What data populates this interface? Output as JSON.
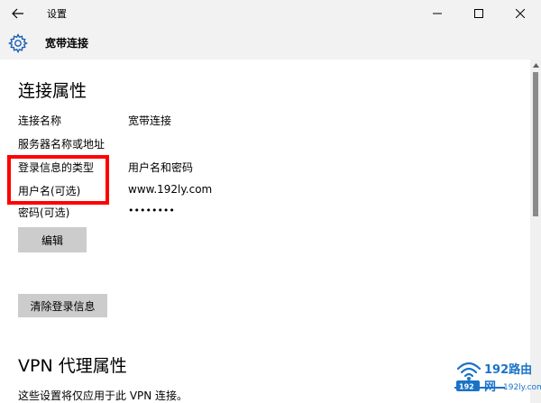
{
  "window": {
    "title": "设置",
    "back_icon": "back-arrow-icon",
    "minimize_icon": "minimize-icon",
    "maximize_icon": "maximize-icon",
    "close_icon": "close-icon"
  },
  "header": {
    "icon": "gear-icon",
    "title": "宽带连接"
  },
  "connection_properties": {
    "heading": "连接属性",
    "rows": [
      {
        "label": "连接名称",
        "value": "宽带连接"
      },
      {
        "label": "服务器名称或地址",
        "value": ""
      },
      {
        "label": "登录信息的类型",
        "value": "用户名和密码"
      },
      {
        "label": "用户名(可选)",
        "value": "www.192ly.com"
      },
      {
        "label": "密码(可选)",
        "value": "••••••••"
      }
    ],
    "edit_button": "编辑",
    "clear_button": "清除登录信息"
  },
  "vpn_proxy": {
    "heading": "VPN 代理属性",
    "note": "这些设置将仅应用于此 VPN 连接。"
  },
  "watermark": {
    "brand": "192路由网",
    "url": "192ly.com",
    "icon": "wifi-signal-icon"
  },
  "colors": {
    "chrome_bg": "#f2f2f2",
    "button_bg": "#cccccc",
    "highlight": "#ff0000",
    "watermark": "#1a73c7"
  }
}
